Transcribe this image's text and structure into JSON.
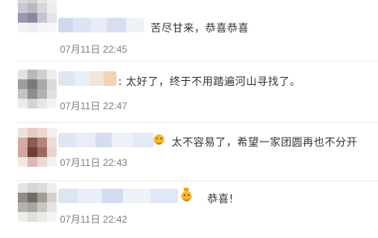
{
  "comments": [
    {
      "text": "苦尽甘来，恭喜恭喜",
      "time": "07月11日 22:45"
    },
    {
      "text": "太好了，终于不用踏遍河山寻找了。",
      "time": "07月11日 22:47"
    },
    {
      "text": "太不容易了，希望一家团圆再也不分开",
      "time": "07月11日 22:43"
    },
    {
      "text": "恭喜!",
      "time": "07月11日 22:42"
    }
  ],
  "colors": {
    "comment_text": "#333333",
    "timestamp": "#7f7f7f",
    "divider": "#ececec"
  },
  "icons": [
    "blurred-avatar",
    "blurred-username",
    "emoji-icon"
  ]
}
